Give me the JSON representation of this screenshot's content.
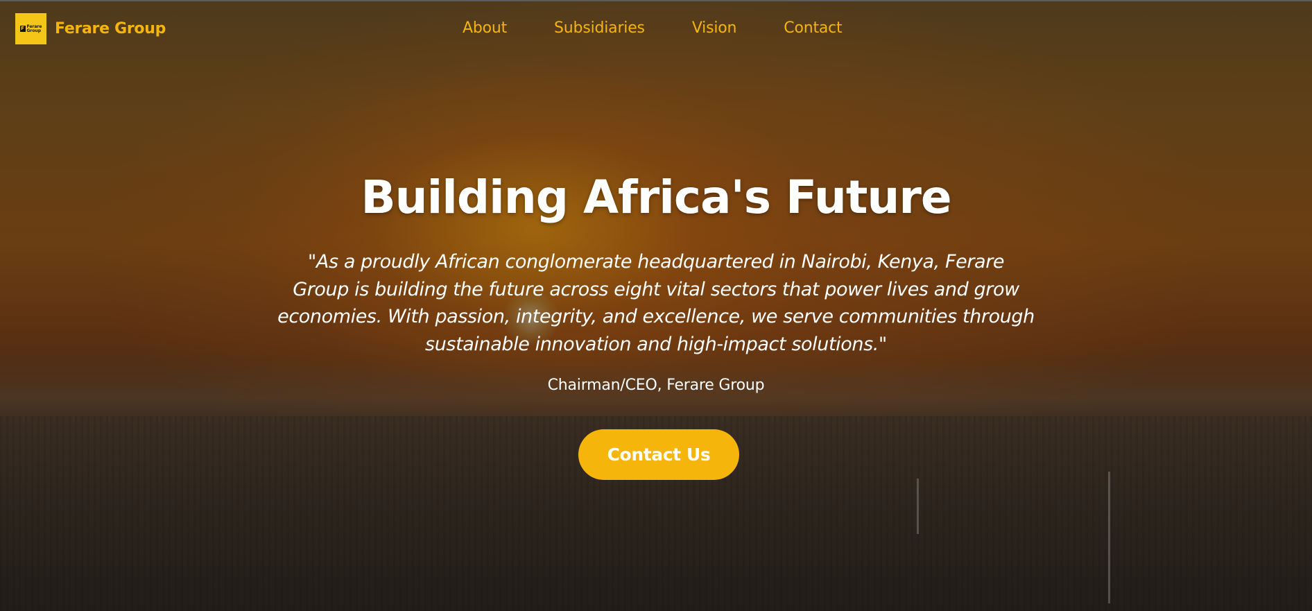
{
  "brand": {
    "logo_mark": "F",
    "logo_text": "Ferare Group",
    "name": "Ferare Group"
  },
  "nav": {
    "items": [
      {
        "label": "About"
      },
      {
        "label": "Subsidiaries"
      },
      {
        "label": "Vision"
      },
      {
        "label": "Contact"
      }
    ]
  },
  "hero": {
    "headline": "Building Africa's Future",
    "quote": "\"As a proudly African conglomerate headquartered in Nairobi, Kenya, Ferare Group is building the future across eight vital sectors that power lives and grow economies. With passion, integrity, and excellence, we serve communities through sustainable innovation and high-impact solutions.\"",
    "attribution": "Chairman/CEO, Ferare Group",
    "cta_label": "Contact Us"
  },
  "colors": {
    "accent": "#f5b50a",
    "logo_background": "#f5c518",
    "text_primary": "#ffffff"
  }
}
